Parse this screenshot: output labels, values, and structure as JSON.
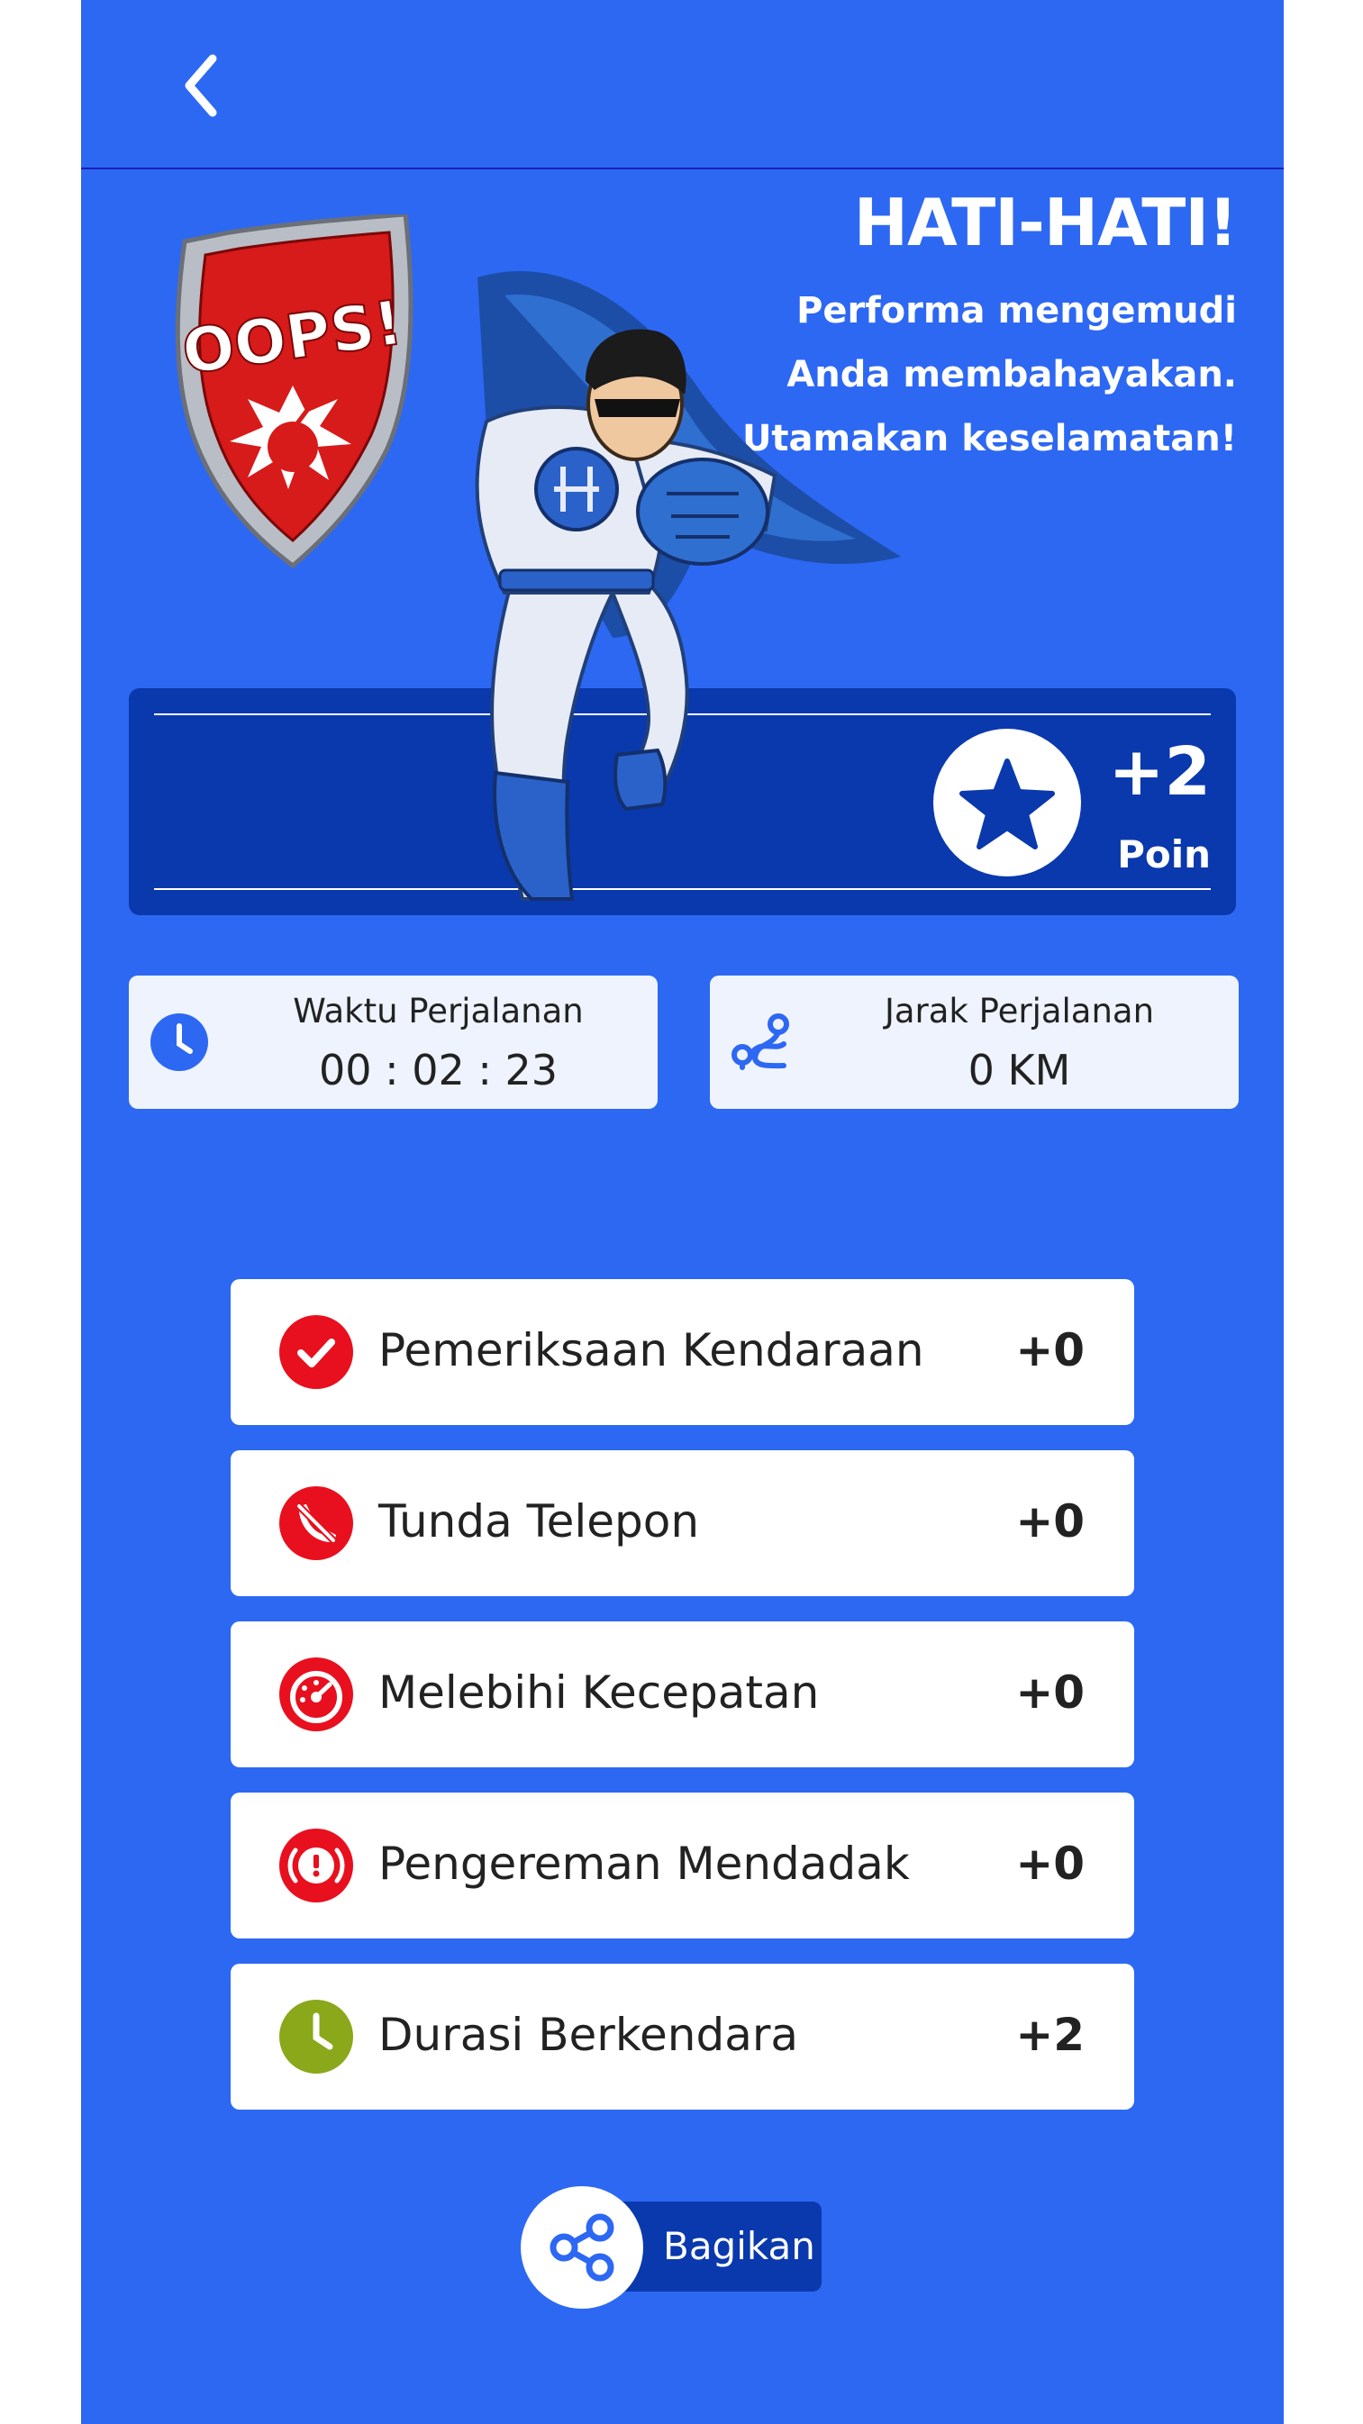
{
  "header": {
    "back_icon": "chevron-left-icon"
  },
  "result": {
    "headline": "HATI-HATI!",
    "message": "Performa mengemudi Anda membahayakan. Utamakan keselamatan!",
    "badge_text": "OOPS!"
  },
  "points": {
    "value": "+2",
    "label": "Poin",
    "icon": "star-icon"
  },
  "stats": {
    "time_label": "Waktu Perjalanan",
    "time_value": "00 : 02 : 23",
    "time_icon": "clock-icon",
    "distance_label": "Jarak Perjalanan",
    "distance_value": "0 KM",
    "distance_icon": "route-icon"
  },
  "score_items": [
    {
      "label": "Pemeriksaan Kendaraan",
      "value": "+0",
      "icon": "check-icon",
      "color": "#e8101e"
    },
    {
      "label": "Tunda Telepon",
      "value": "+0",
      "icon": "phone-off-icon",
      "color": "#e8101e"
    },
    {
      "label": "Melebihi Kecepatan",
      "value": "+0",
      "icon": "speedometer-icon",
      "color": "#e8101e"
    },
    {
      "label": "Pengereman Mendadak",
      "value": "+0",
      "icon": "brake-warning-icon",
      "color": "#e8101e"
    },
    {
      "label": "Durasi Berkendara",
      "value": "+2",
      "icon": "clock-icon",
      "color": "#8aa81a"
    }
  ],
  "share": {
    "label": "Bagikan",
    "icon": "share-icon"
  },
  "colors": {
    "background": "#2d68f3",
    "panel": "#0a39ad",
    "card": "#eef3fd",
    "alert_red": "#e8101e",
    "ok_green": "#8aa81a"
  }
}
